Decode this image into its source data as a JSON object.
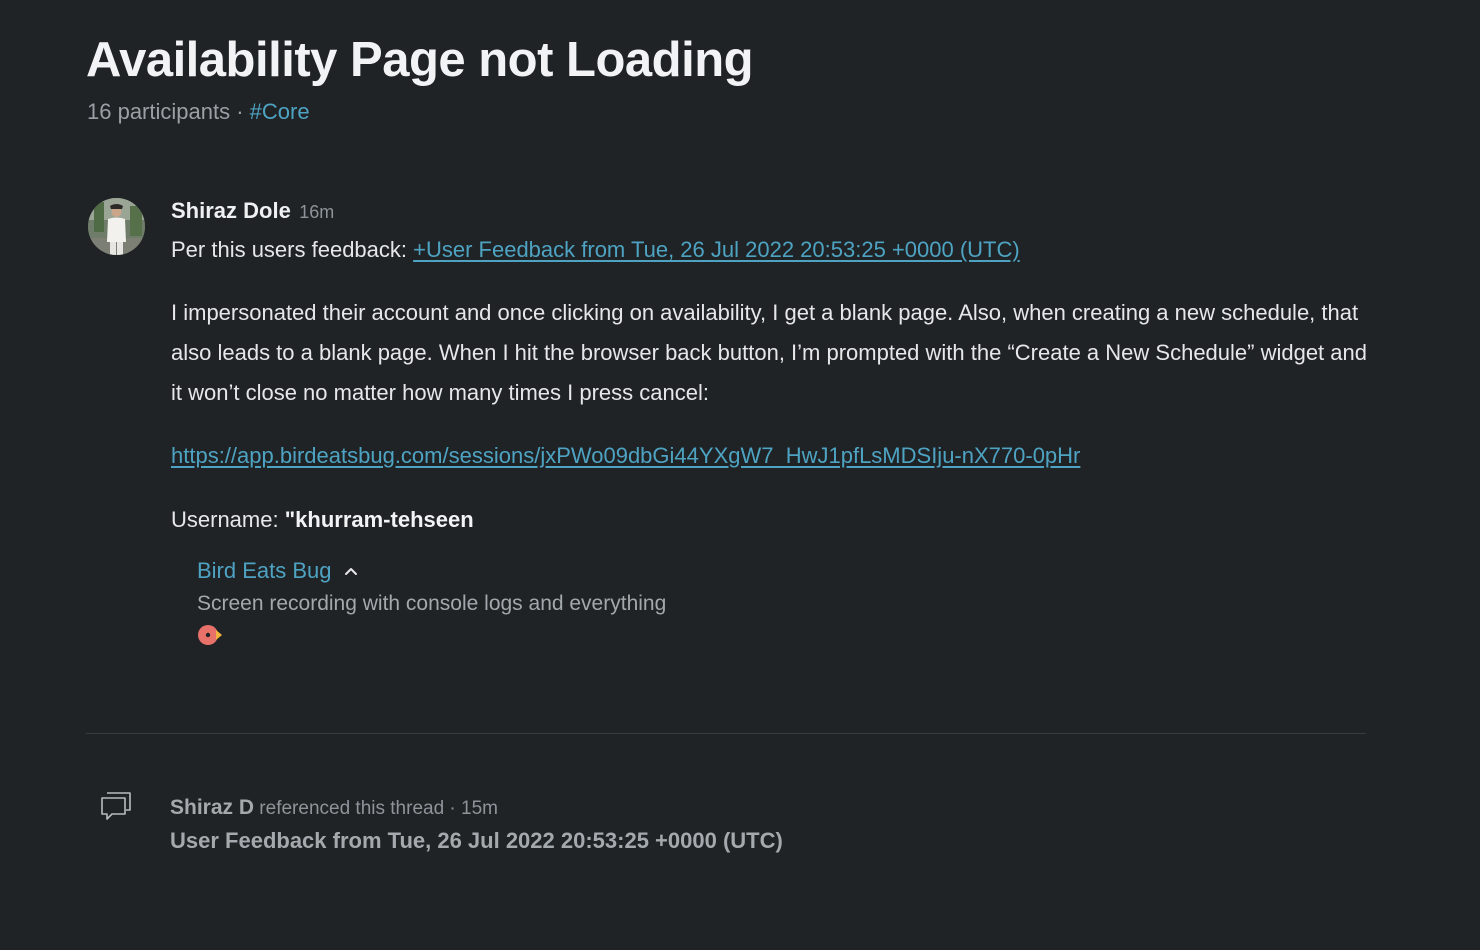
{
  "thread": {
    "title": "Availability Page not Loading",
    "participants": "16 participants",
    "separator": "·",
    "channel": "#Core"
  },
  "message": {
    "author": "Shiraz Dole",
    "time": "16m",
    "p1_prefix": "Per this users feedback: ",
    "p1_link": "+User Feedback from Tue, 26 Jul 2022 20:53:25 +0000 (UTC)",
    "p2": "I impersonated their account and once clicking on availability, I get a blank page. Also, when creating a new schedule, that also leads to a blank page. When I hit the browser back button, I’m prompted with the “Create a New Schedule” widget and it won’t close no matter how many times I press cancel:",
    "p3_link": "https://app.birdeatsbug.com/sessions/jxPWo09dbGi44YXgW7_HwJ1pfLsMDSIju-nX770-0pHr",
    "p4_label": "Username: ",
    "p4_value": "\"khurram-tehseen"
  },
  "unfurl": {
    "title": "Bird Eats Bug",
    "description": "Screen recording with console logs and everything"
  },
  "reference": {
    "author": "Shiraz D",
    "action": " referenced this thread · 15m",
    "title": "User Feedback from Tue, 26 Jul 2022 20:53:25 +0000 (UTC)"
  },
  "colors": {
    "background": "#1f2326",
    "link": "#4ea3c2",
    "muted": "#8e949a"
  },
  "icons": {
    "avatar": "user-avatar",
    "chevron": "chevron-up-icon",
    "unfurl_logo": "bird-eats-bug-logo-icon",
    "reference": "chat-bubbles-icon"
  }
}
